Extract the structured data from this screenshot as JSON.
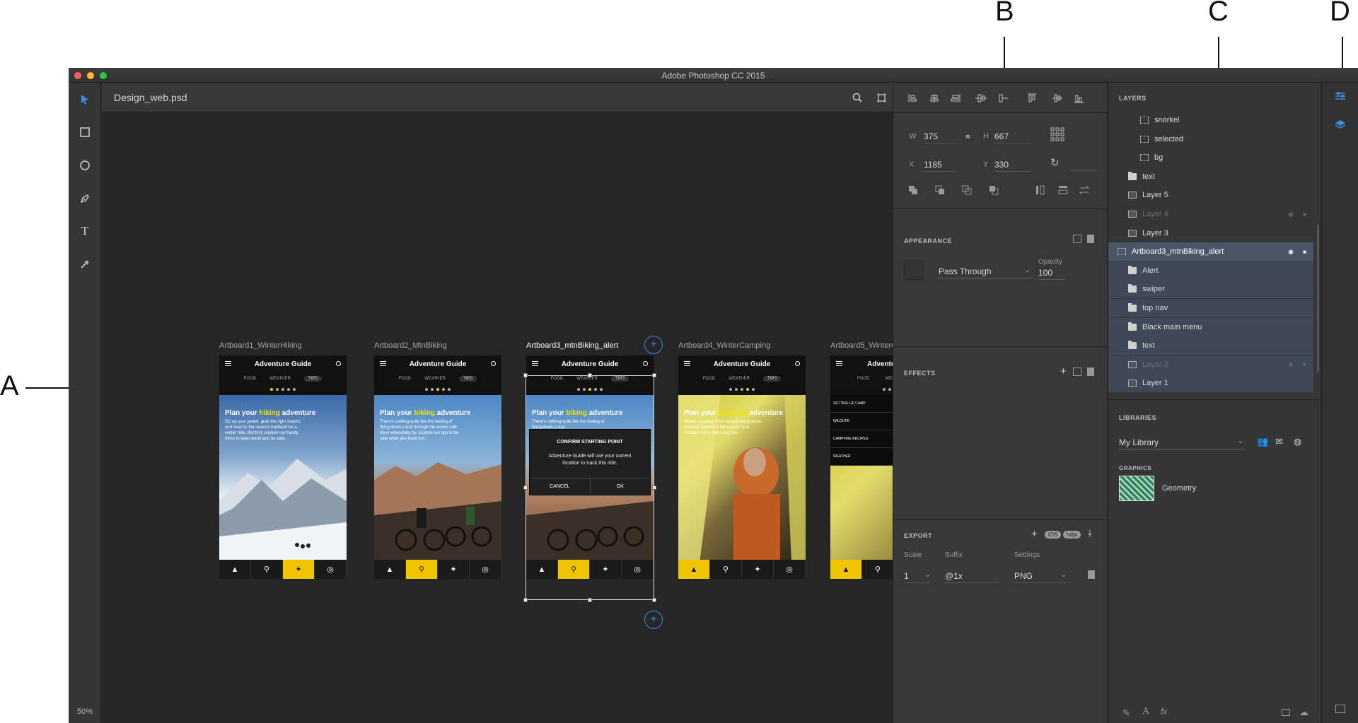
{
  "callouts": {
    "a": "A",
    "b": "B",
    "c": "C",
    "d": "D"
  },
  "window": {
    "title": "Adobe Photoshop CC 2015",
    "document": "Design_web.psd",
    "zoom": "50%"
  },
  "tools": [
    "move-tool",
    "rectangle-tool",
    "ellipse-tool",
    "pen-tool",
    "type-tool",
    "eyedropper-tool"
  ],
  "artboards": [
    {
      "label": "Artboard1_WinterHiking",
      "title": "Adventure Guide",
      "tabs": [
        "FOOD",
        "WEATHER",
        "TIPS"
      ],
      "headline_pre": "Plan your ",
      "headline_hl": "hiking",
      "headline_post": " adventure",
      "body": "Zip up your jacket, grab the right snacks, and head to the nearest trailhead for a winter hike. But first, explore our handy tricks to keep warm and be safe."
    },
    {
      "label": "Artboard2_MtnBiking",
      "title": "Adventure Guide",
      "tabs": [
        "FOOD",
        "WEATHER",
        "TIPS"
      ],
      "headline_pre": "Plan your ",
      "headline_hl": "biking",
      "headline_post": " adventure",
      "body": "There's nothing quite like the feeling of flying down a trail through the woods with trees whooshing by. Explore our tips to be safe while you have fun."
    },
    {
      "label": "Artboard3_mtnBiking_alert",
      "title": "Adventure Guide",
      "tabs": [
        "FOOD",
        "WEATHER",
        "TIPS"
      ],
      "headline_pre": "Plan your ",
      "headline_hl": "biking",
      "headline_post": " adventure",
      "body": "There's nothing quite like the feeling of flying down a trail",
      "alert": {
        "title": "CONFIRM STARTING POINT",
        "body": "Adventure Guide will use your current location to track this ride.",
        "cancel": "CANCEL",
        "ok": "OK"
      }
    },
    {
      "label": "Artboard4_WinterCamping",
      "title": "Adventure Guide",
      "tabs": [
        "FOOD",
        "WEATHER",
        "TIPS"
      ],
      "headline_pre": "Plan your ",
      "headline_hl": "camping",
      "headline_post": " adventure",
      "body": "Winter camping offers breathtaking snow-covered scenery. Find a good spot, consider wind and rising sun."
    },
    {
      "label": "Artboard5_WinterC",
      "title": "Adventure",
      "tabs": [
        "FOOD",
        "WEATH"
      ],
      "menu": [
        "SETTING UP CAMP",
        "WILDLIFE",
        "CAMPFIRE RECIPES",
        "WEATHER"
      ]
    }
  ],
  "properties": {
    "w_label": "W",
    "w": "375",
    "h_label": "H",
    "h": "667",
    "x_label": "X",
    "x": "1185",
    "y_label": "Y",
    "y": "330"
  },
  "appearance": {
    "title": "APPEARANCE",
    "blend": "Pass Through",
    "opacity_label": "Opacity",
    "opacity": "100"
  },
  "effects": {
    "title": "EFFECTS"
  },
  "export": {
    "title": "EXPORT",
    "badge_ios": "iOS",
    "badge_hdpi": "hdpi",
    "scale_label": "Scale",
    "suffix_label": "Suffix",
    "settings_label": "Settings",
    "scale": "1",
    "suffix": "@1x",
    "format": "PNG"
  },
  "layers_panel": {
    "title": "LAYERS",
    "layers": [
      {
        "name": "snorkel",
        "kind": "artboard-shape",
        "indent": 1
      },
      {
        "name": "selected",
        "kind": "artboard-shape",
        "indent": 1
      },
      {
        "name": "bg",
        "kind": "artboard-shape",
        "indent": 1
      },
      {
        "name": "text",
        "kind": "folder",
        "indent": 0
      },
      {
        "name": "Layer 5",
        "kind": "image",
        "indent": 0
      },
      {
        "name": "Layer 4",
        "kind": "image",
        "indent": 0,
        "dim": true
      },
      {
        "name": "Layer 3",
        "kind": "image",
        "indent": 0
      },
      {
        "name": "Artboard3_mtnBiking_alert",
        "kind": "artboard",
        "indent": -1,
        "selected": true
      },
      {
        "name": "Alert",
        "kind": "folder",
        "indent": 0,
        "child": true
      },
      {
        "name": "swiper",
        "kind": "folder",
        "indent": 0,
        "child": true
      },
      {
        "name": "top nav",
        "kind": "folder",
        "indent": 0,
        "child": true
      },
      {
        "name": "Black main menu",
        "kind": "folder",
        "indent": 0,
        "child": true
      },
      {
        "name": "text",
        "kind": "folder",
        "indent": 0,
        "child": true
      },
      {
        "name": "Layer 2",
        "kind": "image",
        "indent": 0,
        "child": true,
        "dim": true
      },
      {
        "name": "Layer 1",
        "kind": "image",
        "indent": 0,
        "child": true
      }
    ]
  },
  "libraries": {
    "title": "LIBRARIES",
    "selected": "My Library",
    "graphics_label": "GRAPHICS",
    "graphic_name": "Geometry"
  },
  "colors": {
    "accent": "#3b8ee8",
    "highlight": "#f2e400",
    "nav_active": "#f1c400",
    "selection": "#4a5667"
  }
}
